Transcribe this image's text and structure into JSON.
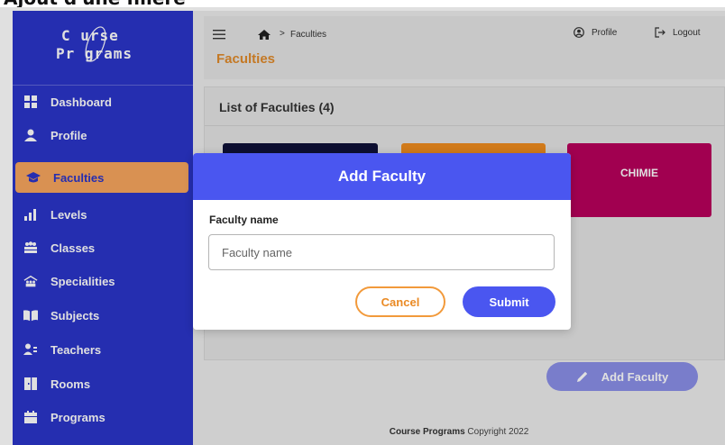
{
  "page_heading": "Ajout d'une filière",
  "logo": {
    "line1": "C  urse",
    "line2": "Pr  grams",
    "alt": "Course Programs"
  },
  "sidebar": {
    "items": [
      {
        "label": "Dashboard",
        "icon": "dashboard-icon"
      },
      {
        "label": "Profile",
        "icon": "user-icon"
      },
      {
        "label": "Faculties",
        "icon": "graduation-cap-icon",
        "active": true
      },
      {
        "label": "Levels",
        "icon": "bar-chart-icon"
      },
      {
        "label": "Classes",
        "icon": "users-group-icon"
      },
      {
        "label": "Specialities",
        "icon": "people-roof-icon"
      },
      {
        "label": "Subjects",
        "icon": "book-icon"
      },
      {
        "label": "Teachers",
        "icon": "teacher-icon"
      },
      {
        "label": "Rooms",
        "icon": "door-icon"
      },
      {
        "label": "Programs",
        "icon": "calendar-icon"
      }
    ]
  },
  "header": {
    "breadcrumb": "Faculties",
    "breadcrumb_sep": ">",
    "title": "Faculties",
    "profile_label": "Profile",
    "logout_label": "Logout"
  },
  "content": {
    "title": "List of Faculties (4)",
    "faculties": [
      {
        "name": "",
        "color": "#0f1238"
      },
      {
        "name": "",
        "color": "#ee8b1e"
      },
      {
        "name": "CHIMIE",
        "color": "#b8005c"
      }
    ]
  },
  "add_button_label": "Add Faculty",
  "footer": {
    "brand": "Course Programs",
    "text": " Copyright 2022"
  },
  "modal": {
    "title": "Add Faculty",
    "field_label": "Faculty name",
    "field_placeholder": "Faculty name",
    "field_value": "",
    "cancel_label": "Cancel",
    "submit_label": "Submit"
  },
  "colors": {
    "sidebar": "#2b35c9",
    "active_item": "#f7a55e",
    "primary": "#4a56f0",
    "accent": "#e08a2b"
  }
}
